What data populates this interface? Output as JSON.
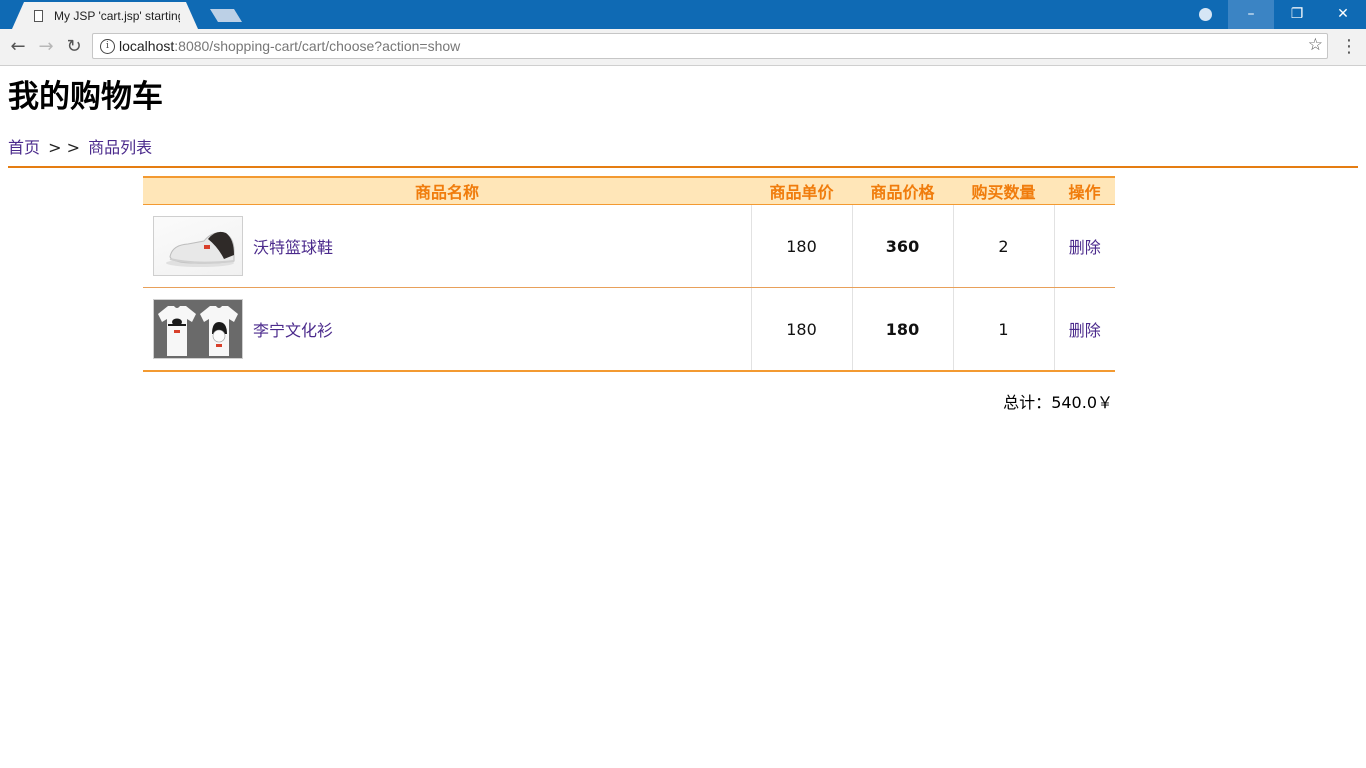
{
  "browser": {
    "tab_title": "My JSP 'cart.jsp' starting page",
    "tab_close": "×",
    "url_host": "localhost",
    "url_rest": ":8080/shopping-cart/cart/choose?action=show",
    "window_controls": {
      "minimize": "–",
      "restore": "❐",
      "close": "✕"
    },
    "nav": {
      "back": "←",
      "forward": "→",
      "reload": "↻",
      "star": "☆",
      "menu": "⋮",
      "info": "i"
    }
  },
  "page": {
    "title": "我的购物车",
    "breadcrumb": {
      "home": "首页",
      "separator": "> >",
      "list": "商品列表"
    }
  },
  "table": {
    "headers": {
      "name": "商品名称",
      "unit_price": "商品单价",
      "total_price": "商品价格",
      "quantity": "购买数量",
      "action": "操作"
    },
    "rows": [
      {
        "name": "沃特篮球鞋",
        "unit_price": "180",
        "total_price": "360",
        "quantity": "2",
        "action": "删除",
        "image_icon": "shoe-image"
      },
      {
        "name": "李宁文化衫",
        "unit_price": "180",
        "total_price": "180",
        "quantity": "1",
        "action": "删除",
        "image_icon": "tshirt-image"
      }
    ]
  },
  "total": {
    "label": "总计：",
    "value": "540.0￥"
  },
  "colors": {
    "accent": "#f07c0c",
    "header_bg": "#ffe6b8",
    "price": "#c0392b",
    "link": "#4b2a8c",
    "titlebar": "#0f6ab4"
  }
}
